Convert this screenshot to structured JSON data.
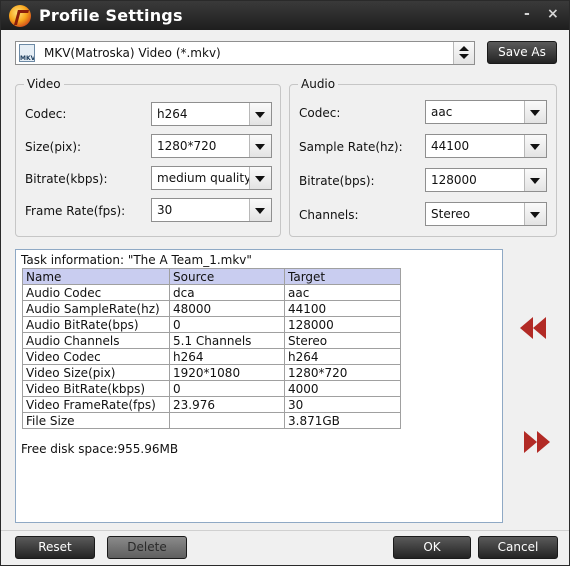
{
  "window": {
    "title": "Profile Settings",
    "minimize": "-",
    "close": "×"
  },
  "format": {
    "icon_text": "MKV",
    "value": "MKV(Matroska) Video (*.mkv)",
    "save_as": "Save As"
  },
  "video": {
    "legend": "Video",
    "codec_label": "Codec:",
    "codec": "h264",
    "size_label": "Size(pix):",
    "size": "1280*720",
    "bitrate_label": "Bitrate(kbps):",
    "bitrate": "medium quality",
    "framerate_label": "Frame Rate(fps):",
    "framerate": "30"
  },
  "audio": {
    "legend": "Audio",
    "codec_label": "Codec:",
    "codec": "aac",
    "samplerate_label": "Sample Rate(hz):",
    "samplerate": "44100",
    "bitrate_label": "Bitrate(bps):",
    "bitrate": "128000",
    "channels_label": "Channels:",
    "channels": "Stereo"
  },
  "task": {
    "title": "Task information: \"The A Team_1.mkv\"",
    "headers": [
      "Name",
      "Source",
      "Target"
    ],
    "rows": [
      [
        "Audio Codec",
        "dca",
        "aac"
      ],
      [
        "Audio SampleRate(hz)",
        "48000",
        "44100"
      ],
      [
        "Audio BitRate(bps)",
        "0",
        "128000"
      ],
      [
        "Audio Channels",
        "5.1 Channels",
        "Stereo"
      ],
      [
        "Video Codec",
        "h264",
        "h264"
      ],
      [
        "Video Size(pix)",
        "1920*1080",
        "1280*720"
      ],
      [
        "Video BitRate(kbps)",
        "0",
        "4000"
      ],
      [
        "Video FrameRate(fps)",
        "23.976",
        "30"
      ],
      [
        "File Size",
        "",
        "3.871GB"
      ]
    ],
    "disk_space": "Free disk space:955.96MB"
  },
  "buttons": {
    "reset": "Reset",
    "delete": "Delete",
    "ok": "OK",
    "cancel": "Cancel"
  },
  "colors": {
    "accent_arrow": "#b22a25",
    "titlebar": "#2a2a2a",
    "table_header": "#c9cdf0"
  }
}
